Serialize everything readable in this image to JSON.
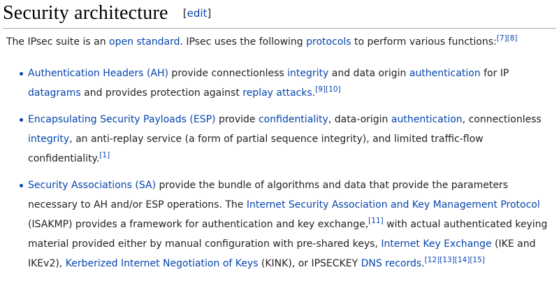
{
  "section": {
    "title": "Security architecture",
    "edit_open": "[",
    "edit_label": "edit",
    "edit_close": "]"
  },
  "intro": {
    "t1": "The IPsec suite is an ",
    "l1": "open standard",
    "t2": ". IPsec uses the following ",
    "l2": "protocols",
    "t3": " to perform various functions:",
    "r1": "[7]",
    "r2": "[8]"
  },
  "items": [
    {
      "l1": "Authentication Headers (AH)",
      "t1": " provide connectionless ",
      "l2": "integrity",
      "t2": " and data origin ",
      "l3": "authentication",
      "t3": " for IP ",
      "l4": "datagrams",
      "t4": " and provides protection against ",
      "l5": "replay attacks",
      "t5": ".",
      "r1": "[9]",
      "r2": "[10]"
    },
    {
      "l1": "Encapsulating Security Payloads (ESP)",
      "t1": " provide ",
      "l2": "confidentiality",
      "t2": ", data-origin ",
      "l3": "authentication",
      "t3": ", connectionless ",
      "l4": "integrity",
      "t4": ", an anti-replay service (a form of partial sequence integrity), and limited traffic-flow confidentiality.",
      "r1": "[1]"
    },
    {
      "l1": "Security Associations (SA)",
      "t1": " provide the bundle of algorithms and data that provide the parameters necessary to AH and/or ESP operations. The ",
      "l2": "Internet Security Association and Key Management Protocol",
      "t2": " (ISAKMP) provides a framework for authentication and key exchange,",
      "r1": "[11]",
      "t3": " with actual authenticated keying material provided either by manual configuration with pre-shared keys, ",
      "l3": "Internet Key Exchange",
      "t4": " (IKE and IKEv2), ",
      "l4": "Kerberized Internet Negotiation of Keys",
      "t5": " (KINK), or IPSECKEY ",
      "l5": "DNS records",
      "t6": ".",
      "r2": "[12]",
      "r3": "[13]",
      "r4": "[14]",
      "r5": "[15]"
    }
  ]
}
